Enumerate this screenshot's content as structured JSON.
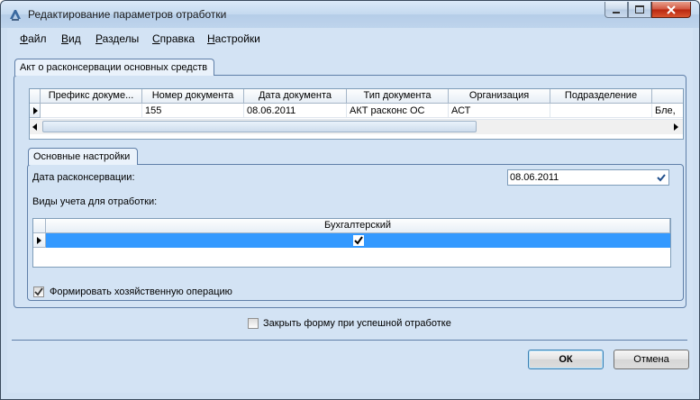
{
  "window": {
    "title": "Редактирование параметров отработки"
  },
  "menu": [
    "Файл",
    "Вид",
    "Разделы",
    "Справка",
    "Настройки"
  ],
  "document_tab": "Акт о расконсервации основных средств",
  "documents_grid": {
    "columns": [
      "Префикс докуме...",
      "Номер документа",
      "Дата документа",
      "Тип документа",
      "Организация",
      "Подразделение"
    ],
    "row": [
      "",
      "155",
      "08.06.2011",
      "АКТ расконс ОС",
      "АСТ",
      "",
      "Бле,"
    ]
  },
  "settings_tab": "Основные настройки",
  "date_label": "Дата расконсервации:",
  "date_value": "08.06.2011",
  "accounting_label": "Виды учета для отработки:",
  "accounting_grid": {
    "column": "Бухгалтерский",
    "checked": true
  },
  "form_operation_label": "Формировать хозяйственную операцию",
  "form_operation_checked": true,
  "close_form_label": "Закрыть форму при успешной отработке",
  "close_form_checked": false,
  "ok_label": "ОК",
  "cancel_label": "Отмена"
}
